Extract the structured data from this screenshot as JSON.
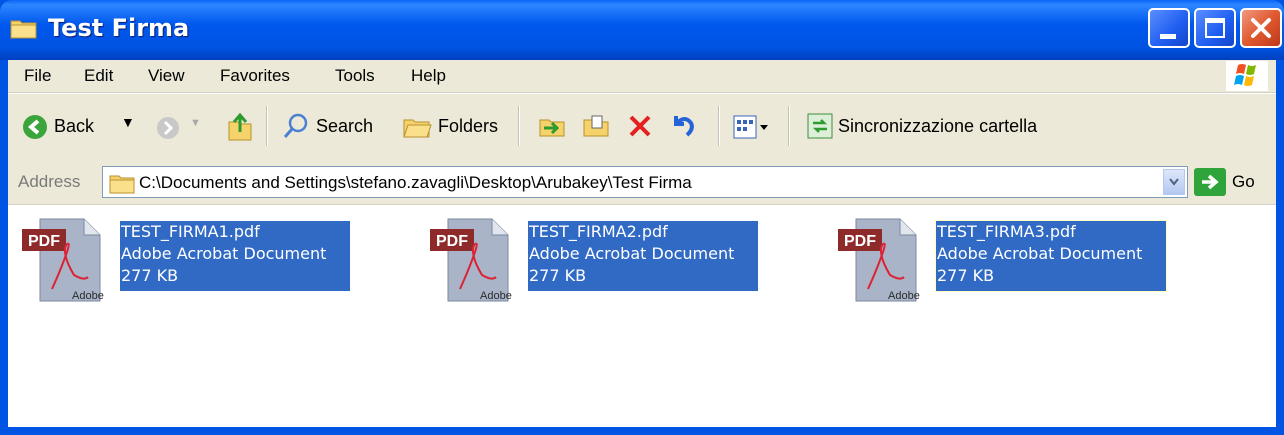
{
  "window": {
    "title": "Test Firma"
  },
  "menu": [
    "File",
    "Edit",
    "View",
    "Favorites",
    "Tools",
    "Help"
  ],
  "toolbar": {
    "back_label": "Back",
    "search_label": "Search",
    "folders_label": "Folders",
    "sync_label": "Sincronizzazione cartella"
  },
  "address": {
    "label": "Address",
    "path": "C:\\Documents and Settings\\stefano.zavagli\\Desktop\\Arubakey\\Test Firma",
    "go_label": "Go"
  },
  "files": [
    {
      "name": "TEST_FIRMA1.pdf",
      "type": "Adobe Acrobat Document",
      "size": "277 KB"
    },
    {
      "name": "TEST_FIRMA2.pdf",
      "type": "Adobe Acrobat Document",
      "size": "277 KB"
    },
    {
      "name": "TEST_FIRMA3.pdf",
      "type": "Adobe Acrobat Document",
      "size": "277 KB"
    }
  ],
  "icon_text": {
    "pdf": "PDF",
    "brand": "Adobe"
  },
  "colors": {
    "titlebar": "#0054E3",
    "selection": "#316AC5",
    "chrome": "#ECE9D8",
    "close": "#E05A30"
  }
}
